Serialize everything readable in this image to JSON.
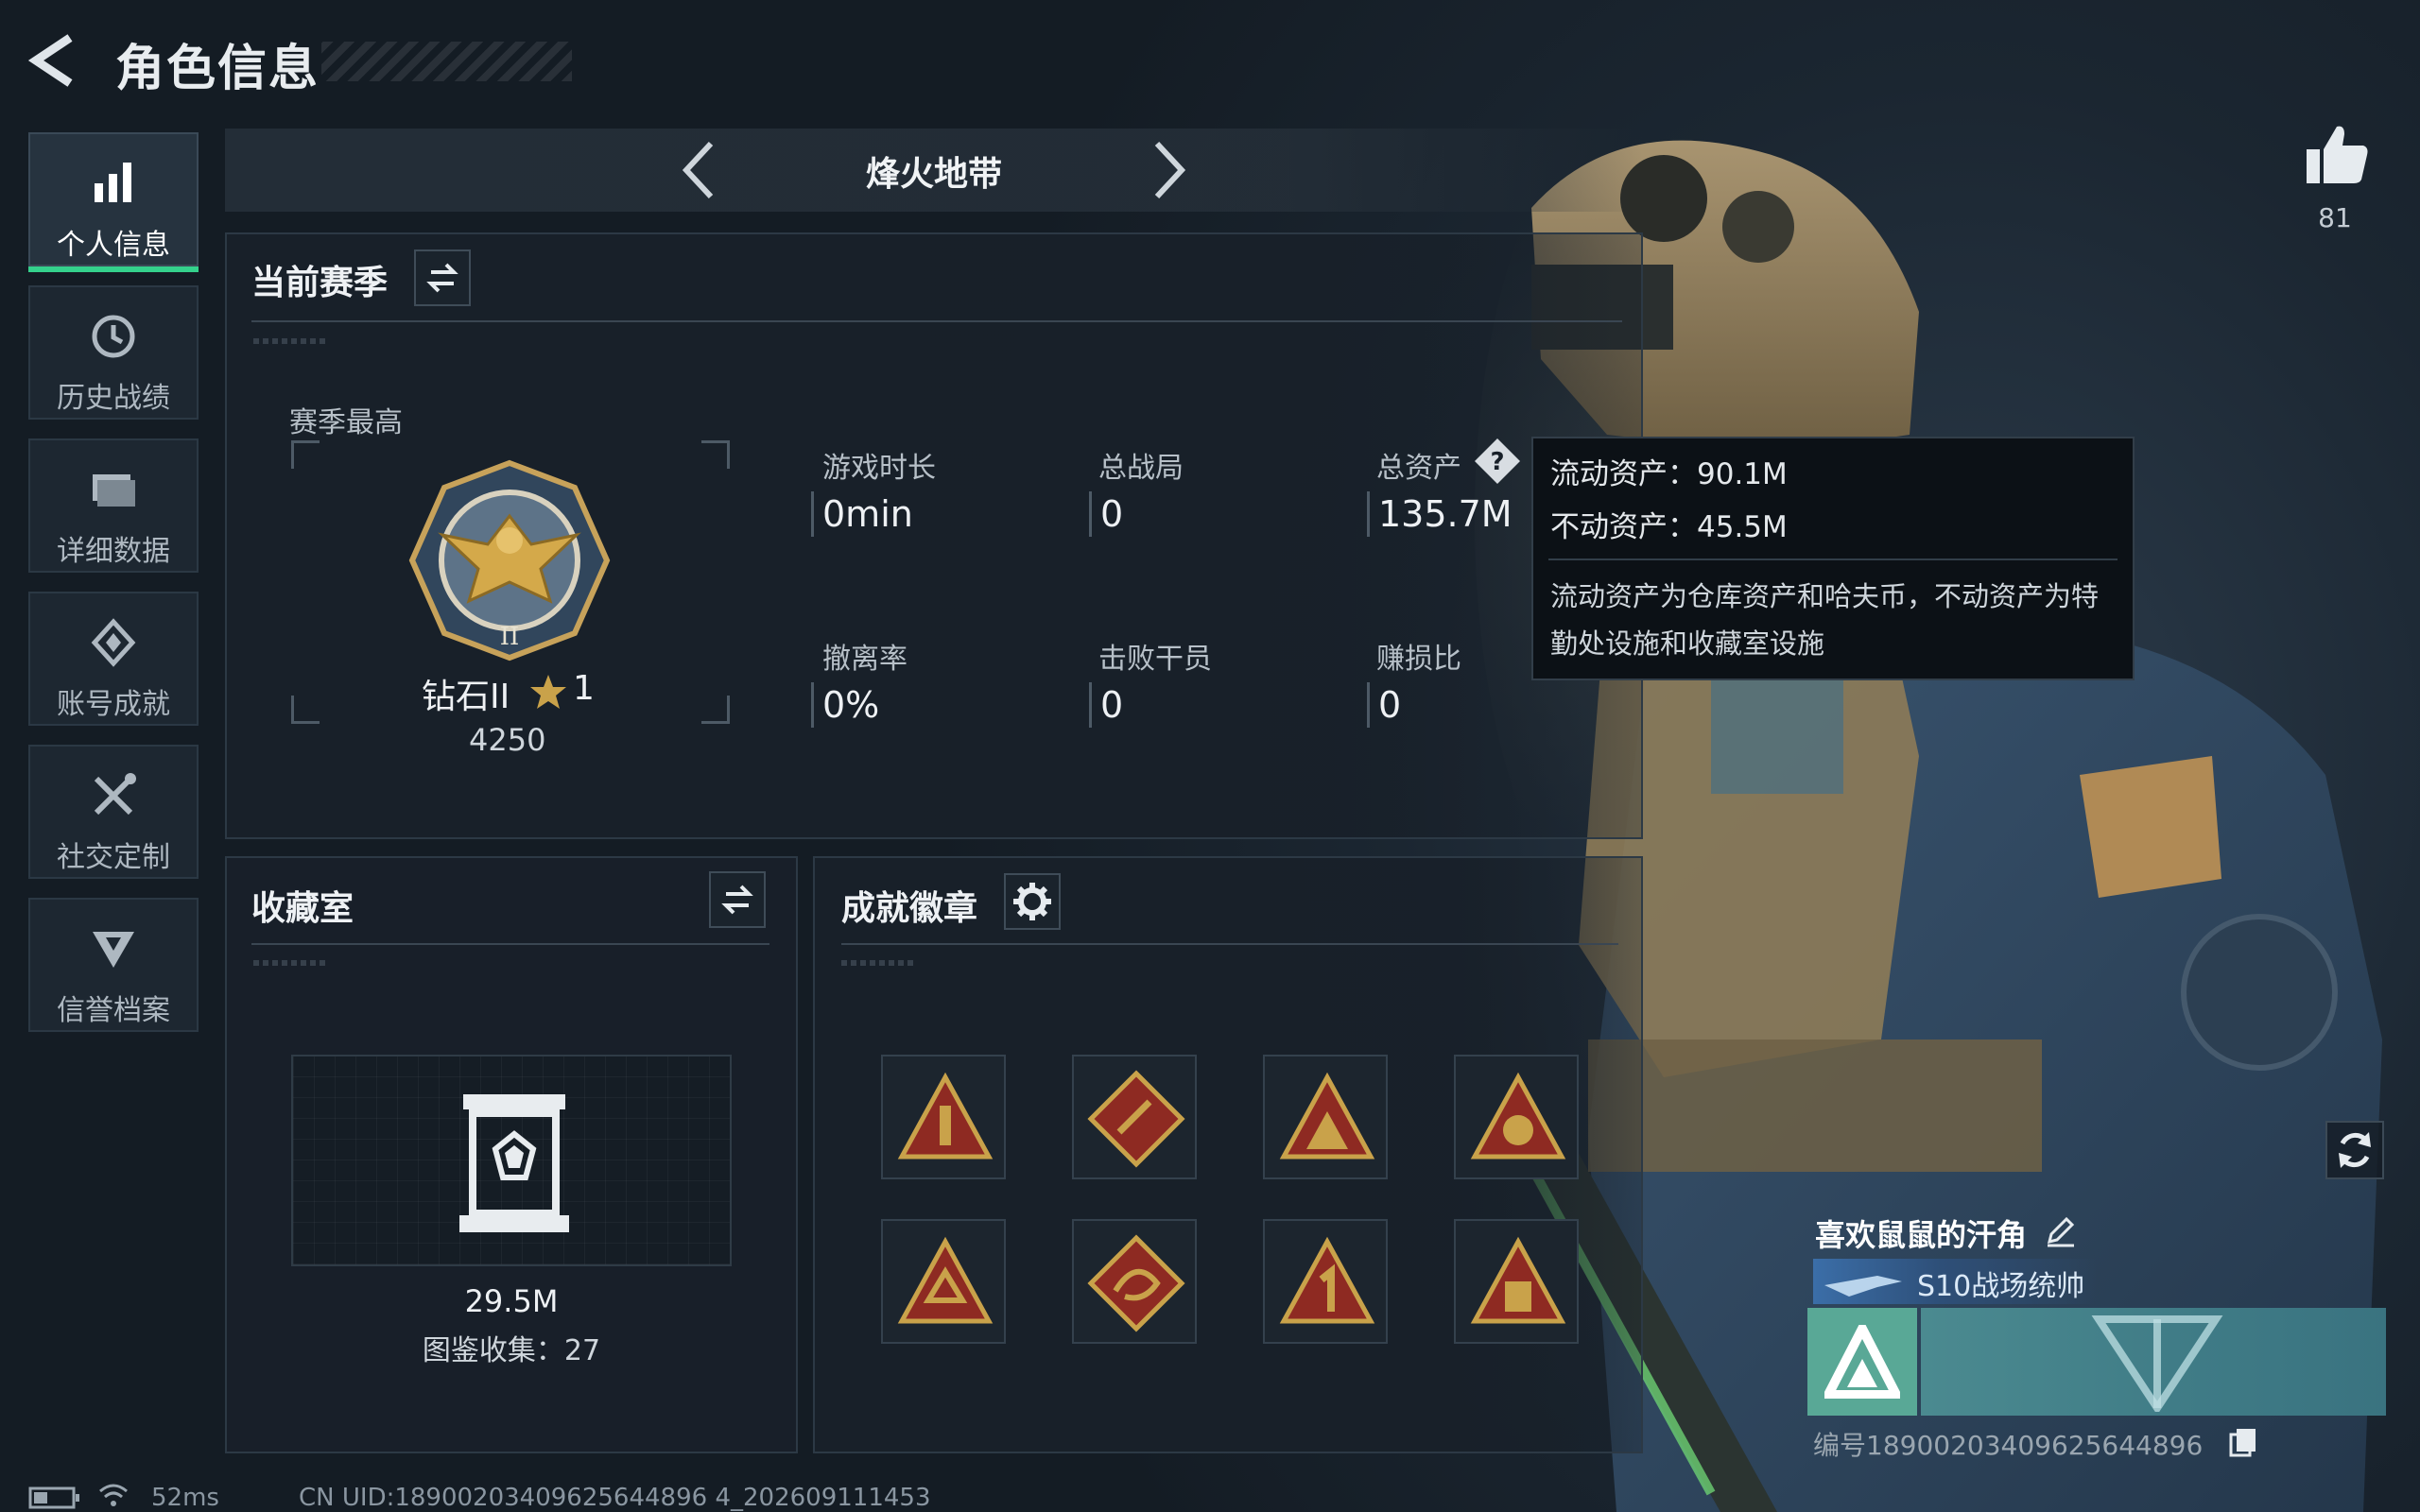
{
  "header": {
    "title": "角色信息"
  },
  "sidebar": {
    "items": [
      {
        "label": "个人信息",
        "icon": "bar-chart-icon",
        "active": true
      },
      {
        "label": "历史战绩",
        "icon": "history-clock-icon"
      },
      {
        "label": "详细数据",
        "icon": "folder-icon"
      },
      {
        "label": "账号成就",
        "icon": "achievement-icon"
      },
      {
        "label": "社交定制",
        "icon": "tools-icon"
      },
      {
        "label": "信誉档案",
        "icon": "credibility-icon"
      }
    ]
  },
  "mode": {
    "title": "烽火地带"
  },
  "season": {
    "title": "当前赛季",
    "peak_label": "赛季最高",
    "rank_name": "钻石II",
    "rank_stars": "1",
    "rank_points": "4250",
    "stats": [
      {
        "label": "游戏时长",
        "value": "0min"
      },
      {
        "label": "总战局",
        "value": "0"
      },
      {
        "label": "总资产",
        "value": "135.7M"
      },
      {
        "label": "撤离率",
        "value": "0%"
      },
      {
        "label": "击败干员",
        "value": "0"
      },
      {
        "label": "赚损比",
        "value": "0"
      }
    ]
  },
  "tooltip": {
    "liquid": "流动资产：90.1M",
    "fixed": "不动资产：45.5M",
    "description": "流动资产为仓库资产和哈夫币，不动资产为特勤处设施和收藏室设施"
  },
  "collection": {
    "title": "收藏室",
    "value": "29.5M",
    "count_text": "图鉴收集：27"
  },
  "badges": {
    "title": "成就徽章",
    "items": [
      {
        "icon": "triangle-badge-icon"
      },
      {
        "icon": "diamond-badge-icon"
      },
      {
        "icon": "triangle-badge-icon"
      },
      {
        "icon": "triangle-badge-icon"
      },
      {
        "icon": "triangle-badge-icon"
      },
      {
        "icon": "dragon-badge-icon"
      },
      {
        "icon": "number-one-badge-icon"
      },
      {
        "icon": "triangle-badge-icon"
      }
    ]
  },
  "profile": {
    "likes": "81",
    "name": "喜欢鼠鼠的汗角",
    "title_plate": "S10战场统帅",
    "id_text": "编号18900203409625644896"
  },
  "status": {
    "ping": "52ms",
    "uid": "CN UID:18900203409625644896 4_202609111453"
  },
  "colors": {
    "accent": "#34d18c",
    "gold": "#c9a24a",
    "badge_red": "#8e2a22"
  }
}
